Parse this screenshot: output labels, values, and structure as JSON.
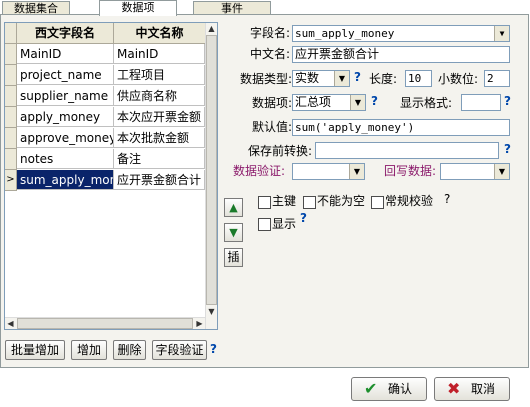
{
  "tabs": [
    {
      "label": "数据集合"
    },
    {
      "label": "数据项"
    },
    {
      "label": "事件"
    }
  ],
  "grid": {
    "headers": [
      "西文字段名",
      "中文名称"
    ],
    "rows": [
      {
        "en": "MainID",
        "cn": "MainID",
        "indicator": ""
      },
      {
        "en": "project_name",
        "cn": "工程项目",
        "indicator": ""
      },
      {
        "en": "supplier_name",
        "cn": "供应商名称",
        "indicator": ""
      },
      {
        "en": "apply_money",
        "cn": "本次应开票金额",
        "indicator": ""
      },
      {
        "en": "approve_money",
        "cn": "本次批款金额",
        "indicator": ""
      },
      {
        "en": "notes",
        "cn": "备注",
        "indicator": ""
      },
      {
        "en": "sum_apply_money",
        "cn": "应开票金额合计",
        "indicator": ">"
      }
    ]
  },
  "left_buttons": {
    "batch_add": "批量增加",
    "add": "增加",
    "delete": "删除",
    "field_validate": "字段验证",
    "help": "?"
  },
  "move_buttons": {
    "up": "▲",
    "down": "▼",
    "insert": "插"
  },
  "form": {
    "field_name_label": "字段名:",
    "field_name_value": "sum_apply_money",
    "cn_name_label": "中文名:",
    "cn_name_value": "应开票金额合计",
    "data_type_label": "数据类型:",
    "data_type_value": "实数",
    "length_label": "长度:",
    "length_value": "10",
    "decimals_label": "小数位:",
    "decimals_value": "2",
    "data_item_label": "数据项:",
    "data_item_value": "汇总项",
    "display_format_label": "显示格式:",
    "display_format_value": "",
    "default_label": "默认值:",
    "default_value": "sum('apply_money')",
    "convert_label": "保存前转换:",
    "convert_value": "",
    "validate_label": "数据验证:",
    "validate_value": "",
    "writeback_label": "回写数据:",
    "writeback_value": "",
    "help": "?"
  },
  "checks": {
    "primary_key": "主键",
    "not_null": "不能为空",
    "regular_check": "常规校验",
    "display": "显示",
    "help": "?"
  },
  "footer": {
    "ok": "确认",
    "cancel": "取消"
  },
  "colors": {
    "selection": "#0a246a",
    "help": "#0047ab",
    "ok_icon": "#1e8f2e",
    "cancel_icon": "#c0202a"
  }
}
